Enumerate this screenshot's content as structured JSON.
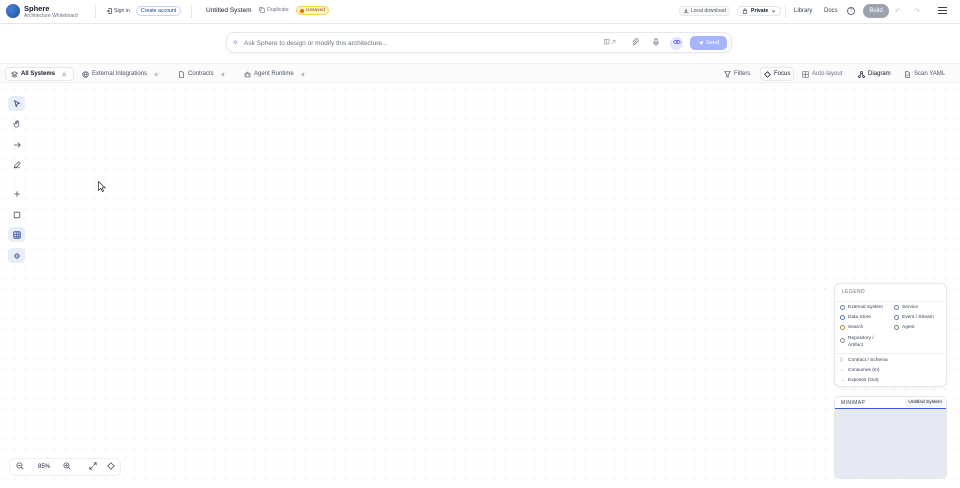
{
  "brand": {
    "name": "Sphere",
    "subtitle": "Architecture Whiteboard"
  },
  "header": {
    "sign_in": "Sign in",
    "create_account": "Create account",
    "document_title": "Untitled System",
    "duplicate": "Duplicate",
    "status_badge": "Unsaved",
    "local_download": "Local download",
    "visibility": "Private",
    "nav": {
      "library": "Library",
      "docs": "Docs"
    },
    "build": "Build"
  },
  "prompt": {
    "placeholder": "Ask Sphere to design or modify this architecture...",
    "send": "Send"
  },
  "subbar": {
    "tabs": [
      {
        "label": "All Systems",
        "count": "0",
        "icon": "layers-icon"
      },
      {
        "label": "External Integrations",
        "count": "0",
        "icon": "globe-icon"
      },
      {
        "label": "Contracts",
        "count": "0",
        "icon": "document-icon"
      },
      {
        "label": "Agent Runtime",
        "count": "0",
        "icon": "robot-icon"
      }
    ],
    "actions": {
      "filters": "Filters",
      "focus": "Focus",
      "auto_layout": "Auto-layout",
      "diagram": "Diagram",
      "scan_yaml": "Scan YAML"
    }
  },
  "legend": {
    "title": "LEGEND",
    "nodes": [
      {
        "label": "External System",
        "color": "#6b7fa3"
      },
      {
        "label": "Service",
        "color": "#6b7fa3"
      },
      {
        "label": "Data Store",
        "color": "#4b7bb5"
      },
      {
        "label": "Event / Stream",
        "color": "#6b7fa3"
      },
      {
        "label": "Search",
        "color": "#b58a3c"
      },
      {
        "label": "Agent",
        "color": "#5f8f5f"
      },
      {
        "label": "Repository / Artifact",
        "color": "#8a8f99"
      }
    ],
    "edges": [
      {
        "label": "Contract / Schema",
        "icon": "document-icon"
      },
      {
        "label": "Consumes (In)",
        "icon": "arrow-left-icon"
      },
      {
        "label": "Exposes (Out)",
        "icon": "arrow-right-icon"
      }
    ]
  },
  "minimap": {
    "title": "MINIMAP",
    "system_label": "Untitled System"
  },
  "zoom": {
    "level": "85%"
  },
  "colors": {
    "accent": "#3b5bdb",
    "build_disabled": "#9ca3af",
    "send_disabled": "#a5b4fc"
  }
}
